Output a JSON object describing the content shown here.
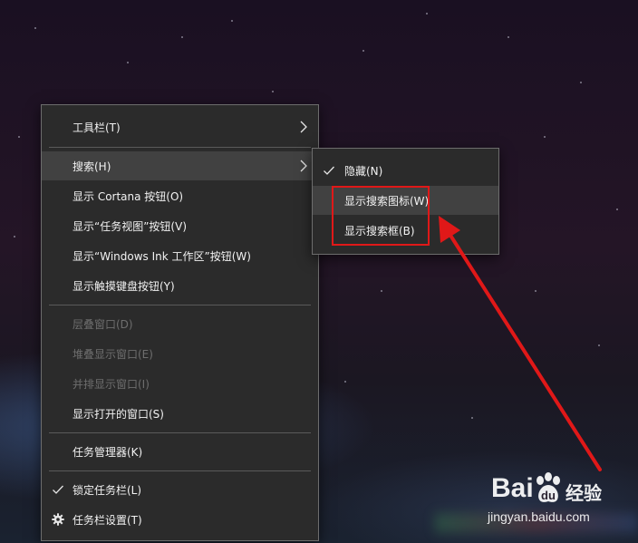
{
  "main_menu": {
    "items": [
      {
        "label": "工具栏(T)"
      },
      {
        "label": "搜索(H)"
      },
      {
        "label": "显示 Cortana 按钮(O)"
      },
      {
        "label": "显示“任务视图”按钮(V)"
      },
      {
        "label": "显示“Windows Ink 工作区”按钮(W)"
      },
      {
        "label": "显示触摸键盘按钮(Y)"
      },
      {
        "label": "层叠窗口(D)"
      },
      {
        "label": "堆叠显示窗口(E)"
      },
      {
        "label": "并排显示窗口(I)"
      },
      {
        "label": "显示打开的窗口(S)"
      },
      {
        "label": "任务管理器(K)"
      },
      {
        "label": "锁定任务栏(L)"
      },
      {
        "label": "任务栏设置(T)"
      }
    ]
  },
  "sub_menu": {
    "items": [
      {
        "label": "隐藏(N)"
      },
      {
        "label": "显示搜索图标(W)"
      },
      {
        "label": "显示搜索框(B)"
      }
    ]
  },
  "watermark": {
    "logo": "Bai",
    "logo_suffix": "经验",
    "url": "jingyan.baidu.com"
  },
  "colors": {
    "menu_bg": "#2b2b2b",
    "hover_bg": "#414141",
    "annotation_red": "#e01818"
  }
}
